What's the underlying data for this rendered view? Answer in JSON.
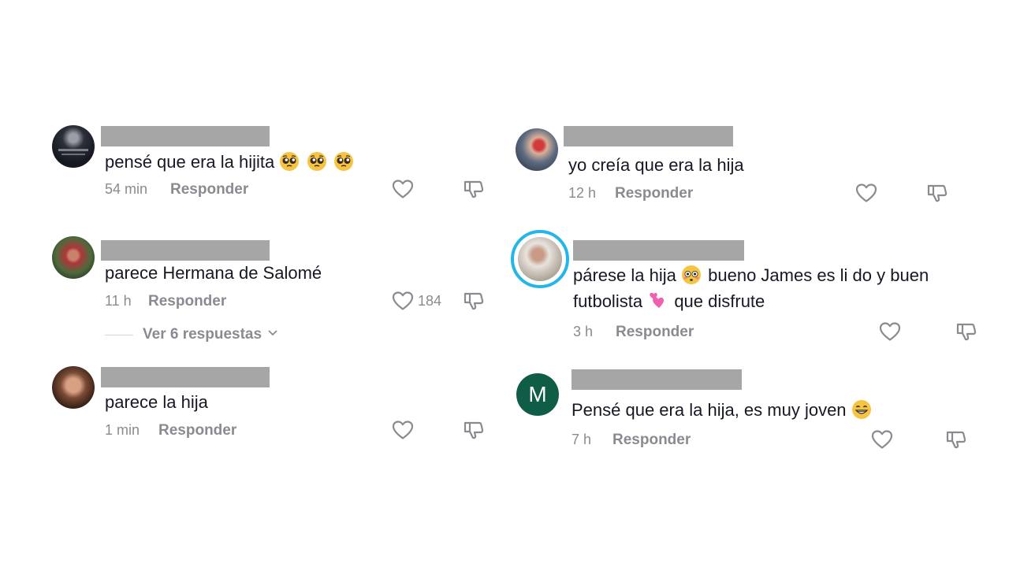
{
  "left_comments": [
    {
      "text": "pensé que era la hijita",
      "emojis": [
        "pleading-face",
        "pleading-face",
        "pleading-face"
      ],
      "time": "54 min",
      "reply_label": "Responder",
      "likes": ""
    },
    {
      "text": "parece Hermana de Salomé",
      "emojis": [],
      "time": "11 h",
      "reply_label": "Responder",
      "likes": "184",
      "thread": {
        "label": "Ver 6 respuestas"
      }
    },
    {
      "text": "parece la hija",
      "emojis": [],
      "time": "1 min",
      "reply_label": "Responder",
      "likes": ""
    }
  ],
  "right_comments": [
    {
      "text": "yo creía que era la hija",
      "time": "12 h",
      "reply_label": "Responder"
    },
    {
      "text_line1": "párese la hija",
      "text_line1_rest": "bueno James es li do y buen",
      "text_line2_a": "futbolista",
      "text_line2_b": "que disfrute",
      "emojis": [
        "flushed-face",
        "two-hearts"
      ],
      "time": "3 h",
      "reply_label": "Responder"
    },
    {
      "text": "Pensé que era la hija, es muy joven",
      "emojis": [
        "grinning-face"
      ],
      "time": "7 h",
      "reply_label": "Responder",
      "avatar_letter": "M"
    }
  ],
  "colors": {
    "name_placeholder": "#a6a6a6",
    "meta_gray": "#8a8b91",
    "avatar_green": "#0f5c47",
    "story_ring": "#25b6e8"
  }
}
